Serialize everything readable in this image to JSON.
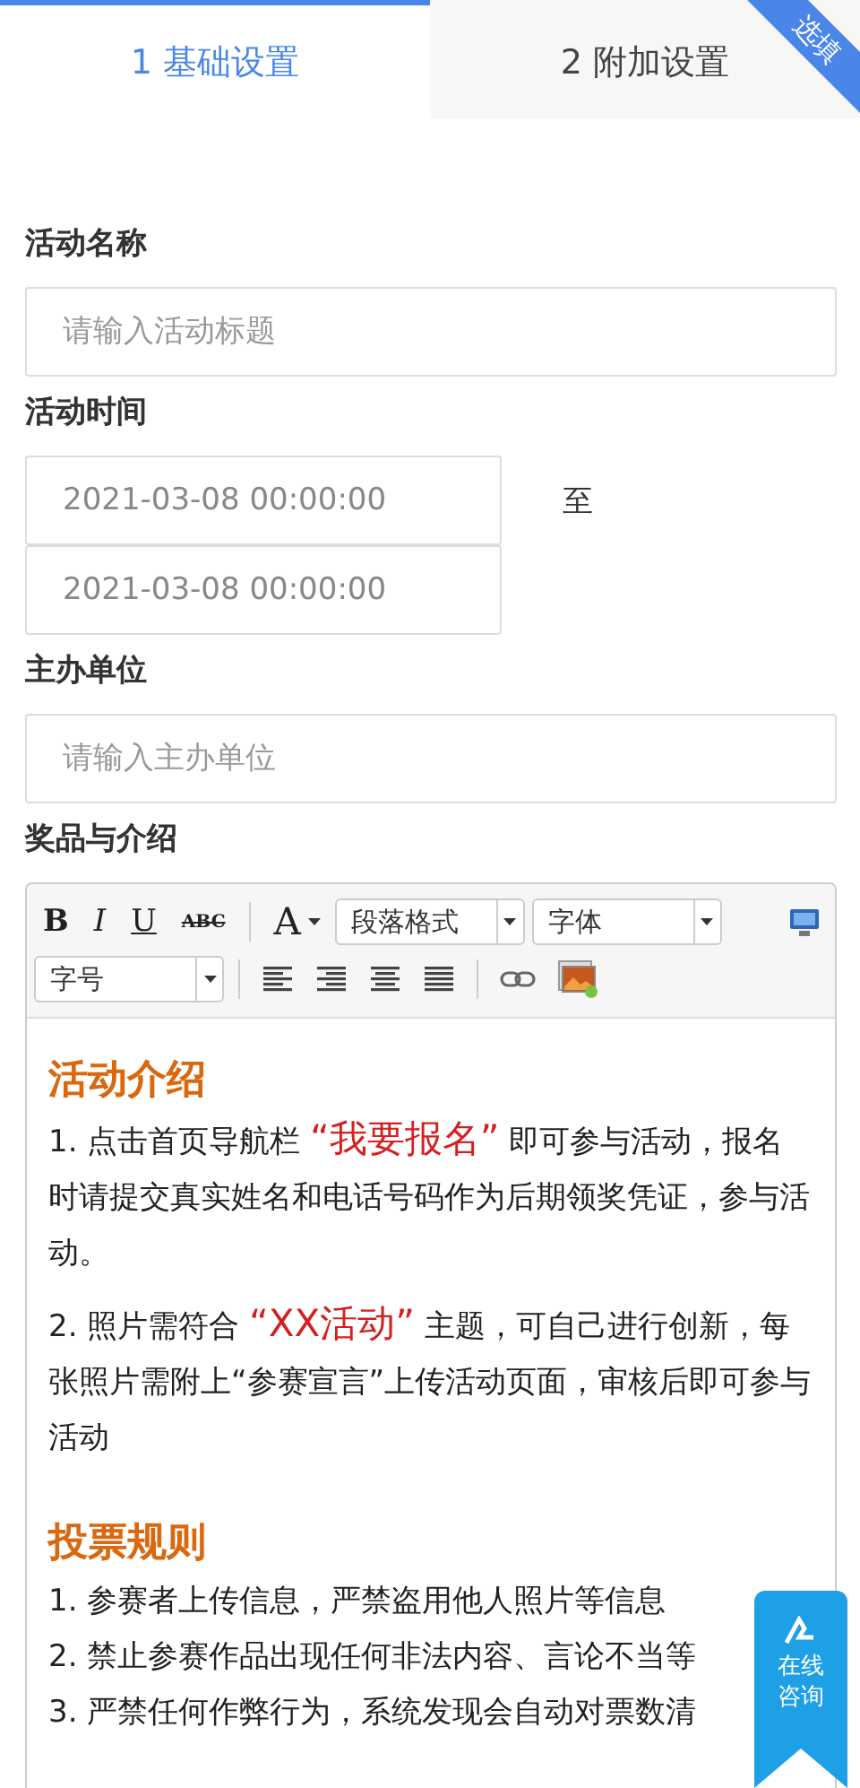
{
  "tabs": [
    {
      "label": "1 基础设置",
      "selected": true
    },
    {
      "label": "2 附加设置",
      "selected": false
    }
  ],
  "corner_ribbon": "选填",
  "fields": [
    {
      "label": "活动名称",
      "kind": "text",
      "placeholder": "请输入活动标题"
    },
    {
      "label": "活动时间",
      "kind": "daterange",
      "start": "2021-03-08 00:00:00",
      "separator": "至",
      "end": "2021-03-08 00:00:00"
    },
    {
      "label": "主办单位",
      "kind": "text",
      "placeholder": "请输入主办单位"
    }
  ],
  "editor": {
    "label": "奖品与介绍",
    "toolbar_row_1": [
      {
        "kind": "bold",
        "text": "B"
      },
      {
        "kind": "italic",
        "text": "I"
      },
      {
        "kind": "underline",
        "text": "U"
      },
      {
        "kind": "strike",
        "text": "ABC"
      },
      {
        "kind": "sep"
      },
      {
        "kind": "color",
        "text": "A"
      },
      {
        "kind": "select",
        "text": "段落格式"
      },
      {
        "kind": "select",
        "text": "字体"
      },
      {
        "kind": "monitor"
      }
    ],
    "toolbar_row_2": [
      {
        "kind": "select",
        "text": "字号"
      },
      {
        "kind": "sep"
      },
      {
        "kind": "align-left"
      },
      {
        "kind": "align-right"
      },
      {
        "kind": "align-center"
      },
      {
        "kind": "align-justify"
      },
      {
        "kind": "sep"
      },
      {
        "kind": "link"
      },
      {
        "kind": "image"
      }
    ],
    "content": [
      {
        "kind": "heading",
        "text": "活动介绍"
      },
      {
        "kind": "paragraph",
        "segments": [
          {
            "text": "1. 点击首页导航栏 ",
            "highlight": false
          },
          {
            "text": "“我要报名”",
            "highlight": true
          },
          {
            "text": " 即可参与活动，报名时请提交真实姓名和电话号码作为后期领奖凭证，参与活动。",
            "highlight": false
          }
        ]
      },
      {
        "kind": "paragraph",
        "segments": [
          {
            "text": "2. 照片需符合 ",
            "highlight": false
          },
          {
            "text": "“XX活动”",
            "highlight": true
          },
          {
            "text": " 主题，可自己进行创新，每张照片需附上“参赛宣言”上传活动页面，审核后即可参与活动",
            "highlight": false
          }
        ]
      },
      {
        "kind": "heading",
        "text": "投票规则"
      },
      {
        "kind": "line",
        "text": "1. 参赛者上传信息，严禁盗用他人照片等信息"
      },
      {
        "kind": "line",
        "text": "2. 禁止参赛作品出现任何非法内容、言论不当等"
      },
      {
        "kind": "line",
        "text": "3. 严禁任何作弊行为，系统发现会自动对票数清"
      }
    ]
  },
  "consult_badge": "在线咨询"
}
